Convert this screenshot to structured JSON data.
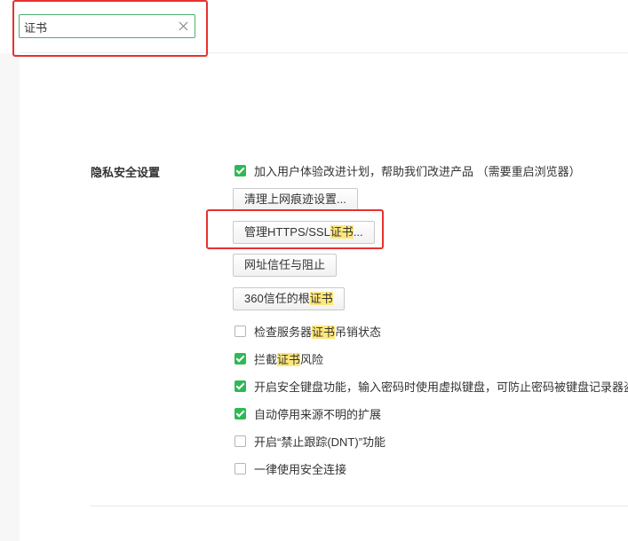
{
  "search": {
    "value": "证书",
    "clear_icon": "close-icon"
  },
  "section": {
    "title": "隐私安全设置"
  },
  "top_option": {
    "label": "加入用户体验改进计划，帮助我们改进产品 （需要重启浏览器）",
    "checked": true
  },
  "buttons": {
    "clear_traces": "清理上网痕迹设置...",
    "https_pre": "管理HTTPS/SSL",
    "https_hl": "证书",
    "https_post": "...",
    "url_trust": "网址信任与阻止",
    "root_pre": "360信任的根",
    "root_hl": "证书"
  },
  "options": {
    "check_revocation": {
      "pre": "检查服务器",
      "hl": "证书",
      "post": "吊销状态",
      "checked": false
    },
    "block_cert_risk": {
      "pre": "拦截",
      "hl": "证书",
      "post": "风险",
      "checked": true
    },
    "secure_keyboard": {
      "label": "开启安全键盘功能，输入密码时使用虚拟键盘，可防止密码被键盘记录器盗取",
      "checked": true
    },
    "disable_unknown_ext": {
      "label": "自动停用来源不明的扩展",
      "checked": true
    },
    "dnt": {
      "label": "开启“禁止跟踪(DNT)”功能",
      "checked": false
    },
    "always_secure": {
      "label": "一律使用安全连接",
      "checked": false
    }
  },
  "colors": {
    "accent": "#30b856",
    "highlight": "#ffe77a",
    "annotation": "#e8312f"
  }
}
